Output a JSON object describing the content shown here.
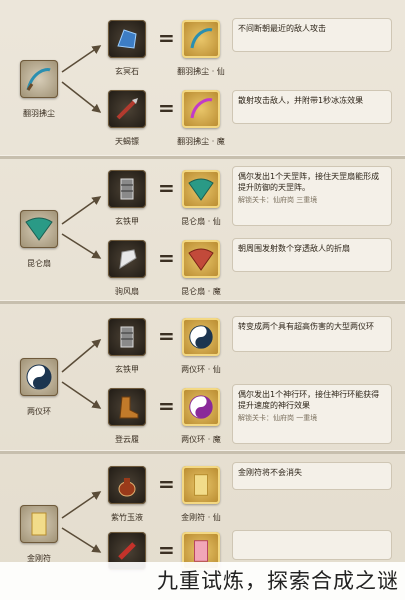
{
  "sections": [
    {
      "base": {
        "label": "翻羽拂尘",
        "icon": "whisk-icon"
      },
      "rows": [
        {
          "material": {
            "label": "玄冥石",
            "icon": "blue-stone-icon"
          },
          "result": {
            "label": "翻羽拂尘 · 仙",
            "icon": "whisk-icon"
          },
          "desc": "不间断朝最近的敌人攻击",
          "sub": ""
        },
        {
          "material": {
            "label": "天蝎镖",
            "icon": "dart-icon"
          },
          "result": {
            "label": "翻羽拂尘 · 魔",
            "icon": "purple-whisk-icon"
          },
          "desc": "散射攻击敌人，并附带1秒冰冻效果",
          "sub": ""
        }
      ]
    },
    {
      "base": {
        "label": "昆仑扇",
        "icon": "fan-icon"
      },
      "rows": [
        {
          "material": {
            "label": "玄铁甲",
            "icon": "armor-icon"
          },
          "result": {
            "label": "昆仑扇 · 仙",
            "icon": "fan-icon"
          },
          "desc": "偶尔发出1个天罡阵，接住天罡扇能形成提升防御的天罡阵。",
          "sub": "解锁关卡：仙府岗  三重境"
        },
        {
          "material": {
            "label": "驹风扇",
            "icon": "feather-fan-icon"
          },
          "result": {
            "label": "昆仑扇 · 魔",
            "icon": "red-fan-icon"
          },
          "desc": "朝周围发射数个穿透敌人的折扇",
          "sub": ""
        }
      ]
    },
    {
      "base": {
        "label": "两仪环",
        "icon": "yinyang-icon"
      },
      "rows": [
        {
          "material": {
            "label": "玄铁甲",
            "icon": "armor-icon"
          },
          "result": {
            "label": "两仪环 · 仙",
            "icon": "yinyang-icon"
          },
          "desc": "转变成两个具有超高伤害的大型两仪环",
          "sub": ""
        },
        {
          "material": {
            "label": "登云履",
            "icon": "boots-icon"
          },
          "result": {
            "label": "两仪环 · 魔",
            "icon": "purple-yinyang-icon"
          },
          "desc": "偶尔发出1个神行环，接住神行环能获得提升速度的神行效果",
          "sub": "解锁关卡：仙府岗  一重境"
        }
      ]
    },
    {
      "base": {
        "label": "金刚符",
        "icon": "talisman-icon"
      },
      "rows": [
        {
          "material": {
            "label": "紫竹玉液",
            "icon": "teapot-icon"
          },
          "result": {
            "label": "金刚符 · 仙",
            "icon": "talisman-icon"
          },
          "desc": "金刚符将不会消失",
          "sub": ""
        },
        {
          "material": {
            "label": "",
            "icon": "red-item-icon"
          },
          "result": {
            "label": "",
            "icon": "pink-talisman-icon"
          },
          "desc": "",
          "sub": ""
        }
      ]
    }
  ],
  "equals_sign": "=",
  "caption": "九重试炼，探索合成之谜",
  "colors": {
    "background": "#e9e3d6",
    "gold_frame": "#e9c66a",
    "dark_frame": "#2a231b",
    "text": "#2d2418"
  }
}
